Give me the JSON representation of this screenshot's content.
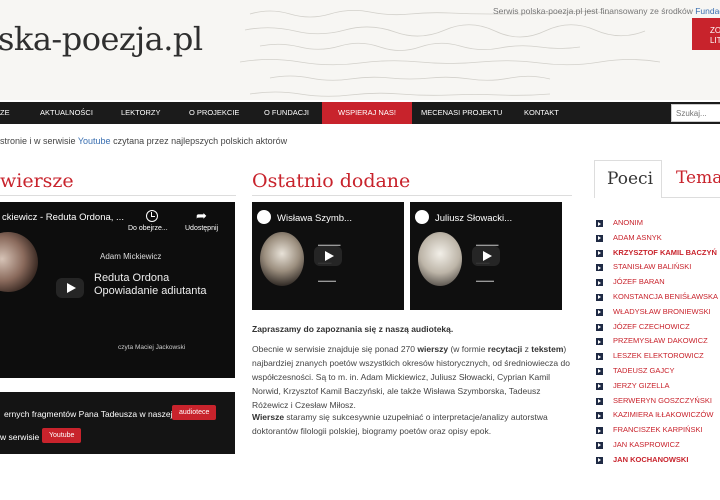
{
  "header": {
    "logo": "ska-poezja.pl",
    "funding_text": "Serwis polska-poezja.pl jest finansowany ze środków",
    "funding_link": "Fundacji im. W",
    "badge_line1": "ZO",
    "badge_line2": "LIT"
  },
  "nav": {
    "items": [
      "ZE",
      "AKTUALNOŚCI",
      "LEKTORZY",
      "O PROJEKCIE",
      "O FUNDACJI",
      "WSPIERAJ NAS!",
      "MECENASI PROJEKTU",
      "KONTAKT"
    ],
    "active": "WSPIERAJ NAS!",
    "search_placeholder": "Szukaj..."
  },
  "intro": {
    "before": "stronie i w serwisie ",
    "link": "Youtube",
    "after": " czytana przez najlepszych polskich aktorów"
  },
  "left": {
    "heading": "wiersze",
    "video": {
      "title": "ckiewicz - Reduta Ordona, ...",
      "watch_later": "Do obejrze...",
      "share": "Udostępnij",
      "author": "Adam Mickiewicz",
      "poem_line1": "Reduta Ordona",
      "poem_line2": "Opowiadanie adiutanta",
      "reader": "czyta Maciej Jackowski"
    },
    "promo": {
      "line1": "ernych fragmentów Pana Tadeusza w naszej",
      "button1": "audiotece",
      "line2": "w serwisie",
      "button2": "Youtube"
    }
  },
  "middle": {
    "heading": "Ostatnio dodane",
    "videos": [
      {
        "title": "Wisława Szymb..."
      },
      {
        "title": "Juliusz Słowacki..."
      }
    ],
    "intro_bold": "Zapraszamy do zapoznania się z naszą audioteką.",
    "p2_a": "Obecnie w serwisie znajduje się ponad 270 ",
    "p2_b1": "wierszy",
    "p2_c": " (w formie ",
    "p2_b2": "recytacji",
    "p2_d": " z ",
    "p2_b3": "tekstem",
    "p2_e": ") najbardziej znanych poetów wszystkich okresów historycznych, od średniowiecza do współczesności. Są to m. in. Adam Mickiewicz, Juliusz Słowacki, Cyprian Kamil Norwid, Krzysztof Kamil Baczyński, ale także Wisława Szymborska, Tadeusz Różewicz i Czesław Miłosz.",
    "p3_b": "Wiersze",
    "p3_rest": " staramy się sukcesywnie uzupełniać o interpretacje/analizy autorstwa doktorantów filologii polskiej, biogramy poetów oraz opisy epok."
  },
  "right": {
    "tab_active": "Poeci",
    "tab_inactive": "Tema",
    "poets": [
      {
        "name": "ANONIM",
        "bold": false
      },
      {
        "name": "ADAM ASNYK",
        "bold": false
      },
      {
        "name": "KRZYSZTOF KAMIL BACZYŃ",
        "bold": true
      },
      {
        "name": "STANISŁAW BALIŃSKI",
        "bold": false
      },
      {
        "name": "JÓZEF BARAN",
        "bold": false
      },
      {
        "name": "KONSTANCJA BENIŚŁAWSKA",
        "bold": false
      },
      {
        "name": "WŁADYSŁAW BRONIEWSKI",
        "bold": false
      },
      {
        "name": "JÓZEF CZECHOWICZ",
        "bold": false
      },
      {
        "name": "PRZEMYSŁAW DAKOWICZ",
        "bold": false
      },
      {
        "name": "LESZEK ELEKTOROWICZ",
        "bold": false
      },
      {
        "name": "TADEUSZ GAJCY",
        "bold": false
      },
      {
        "name": "JERZY GIZELLA",
        "bold": false
      },
      {
        "name": "SERWERYN GOSZCZYŃSKI",
        "bold": false
      },
      {
        "name": "KAZIMIERA IŁŁAKOWICZÓW",
        "bold": false
      },
      {
        "name": "FRANCISZEK KARPIŃSKI",
        "bold": false
      },
      {
        "name": "JAN KASPROWICZ",
        "bold": false
      },
      {
        "name": "JAN KOCHANOWSKI",
        "bold": true
      }
    ]
  },
  "colors": {
    "accent": "#c8232c",
    "nav_bg": "#1b1b1b",
    "link": "#3a6fb0"
  }
}
